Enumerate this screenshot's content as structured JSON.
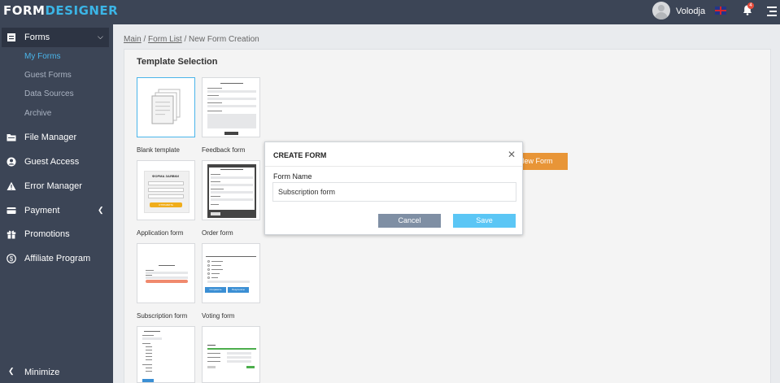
{
  "app": {
    "logo_part1": "FORM",
    "logo_part2": "DESIGNER"
  },
  "header": {
    "username": "Volodja",
    "notification_count": "4"
  },
  "sidebar": {
    "forms_label": "Forms",
    "sub_items": [
      "My Forms",
      "Guest Forms",
      "Data Sources",
      "Archive"
    ],
    "items": [
      "File Manager",
      "Guest Access",
      "Error Manager",
      "Payment",
      "Promotions",
      "Affiliate Program"
    ],
    "minimize_label": "Minimize"
  },
  "breadcrumb": {
    "main": "Main",
    "form_list": "Form List",
    "current": "New Form Creation",
    "sep": "/"
  },
  "section_title": "Template Selection",
  "templates": [
    "Blank template",
    "Feedback form",
    "Application form",
    "Order form",
    "Subscription form",
    "Voting form"
  ],
  "template_previews": {
    "application_title": "ФОРМА ЗАЯВКИ",
    "application_button": "ОТПРАВИТЬ",
    "voting_buttons": [
      "Отправить",
      "Результаты"
    ]
  },
  "new_form_button": "New Form",
  "modal": {
    "title": "CREATE FORM",
    "field_label": "Form Name",
    "field_value": "Subscription form",
    "cancel_label": "Cancel",
    "save_label": "Save"
  },
  "colors": {
    "sidebar_bg": "#3c4556",
    "accent": "#4ab5ea",
    "orange": "#e89537",
    "save": "#5bc6f5",
    "cancel": "#7f8fa4"
  }
}
